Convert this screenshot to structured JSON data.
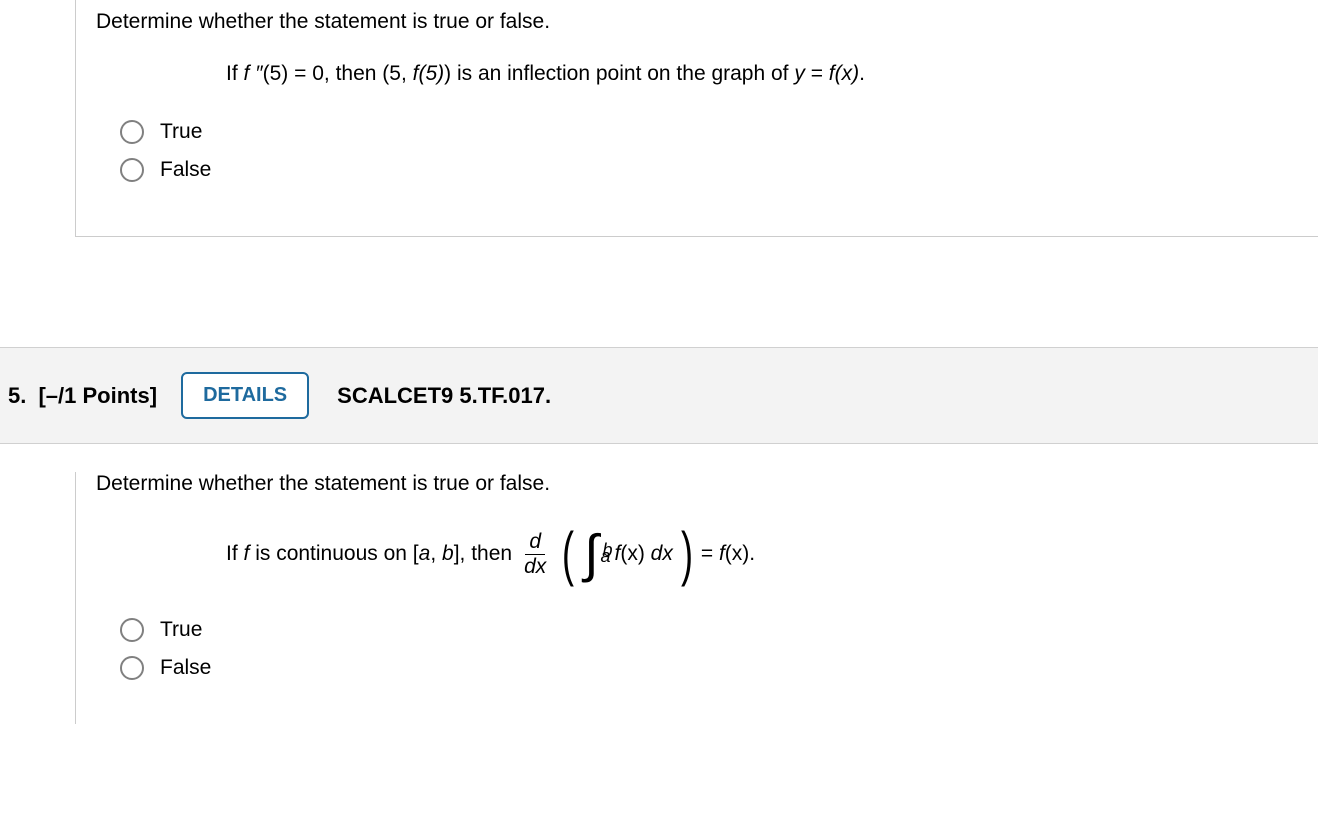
{
  "q1": {
    "prompt": "Determine whether the statement is true or false.",
    "statement_pre": "If ",
    "f_dblprime": "f ″",
    "stmt_lhs_arg": "(5) = 0, then (5, ",
    "f_of_5": "f(5)",
    "stmt_mid": ") is an inflection point on the graph of ",
    "y_eq": "y",
    "eq_sign": " = ",
    "fx": "f(x)",
    "stmt_end": ".",
    "options": {
      "true": "True",
      "false": "False"
    }
  },
  "header": {
    "number": "5.",
    "points": "[–/1 Points]",
    "details": "DETAILS",
    "source": "SCALCET9 5.TF.017."
  },
  "q2": {
    "prompt": "Determine whether the statement is true or false.",
    "pre": "If ",
    "f": "f",
    "cont_on": " is continuous on [",
    "a": "a",
    "comma": ", ",
    "b": "b",
    "close_then": "], then ",
    "d": "d",
    "dx": "dx",
    "int_upper": "b",
    "int_lower": "a",
    "integrand_f": "f",
    "integrand_x": "(x) ",
    "integrand_dx": "dx",
    "eq": " = ",
    "rhs_f": "f",
    "rhs_x": "(x).",
    "options": {
      "true": "True",
      "false": "False"
    }
  }
}
